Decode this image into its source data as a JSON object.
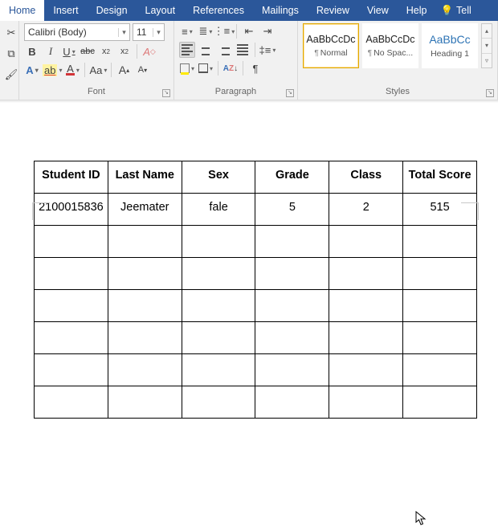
{
  "tabs": {
    "home": "Home",
    "insert": "Insert",
    "design": "Design",
    "layout": "Layout",
    "references": "References",
    "mailings": "Mailings",
    "review": "Review",
    "view": "View",
    "help": "Help",
    "tell": "Tell"
  },
  "font": {
    "group_label": "Font",
    "family": "Calibri (Body)",
    "size": "11",
    "bold": "B",
    "italic": "I",
    "underline": "U",
    "strike": "abc",
    "sub": "x",
    "sup": "x",
    "clear": "A",
    "effects": "A",
    "highlight": "ab",
    "color": "A",
    "case": "Aa",
    "grow": "A",
    "shrink": "A"
  },
  "para": {
    "group_label": "Paragraph",
    "sort": "A↓",
    "pilcrow": "¶"
  },
  "styles": {
    "group_label": "Styles",
    "preview": "AaBbCcDc",
    "preview_h": "AaBbCc",
    "normal": "Normal",
    "nospace": "No Spac...",
    "heading1": "Heading 1"
  },
  "table": {
    "headers": [
      "Student ID",
      "Last Name",
      "Sex",
      "Grade",
      "Class",
      "Total Score"
    ],
    "rows": [
      [
        "2100015836",
        "Jeemater",
        "fale",
        "5",
        "2",
        "515"
      ],
      [
        "",
        "",
        "",
        "",
        "",
        ""
      ],
      [
        "",
        "",
        "",
        "",
        "",
        ""
      ],
      [
        "",
        "",
        "",
        "",
        "",
        ""
      ],
      [
        "",
        "",
        "",
        "",
        "",
        ""
      ],
      [
        "",
        "",
        "",
        "",
        "",
        ""
      ],
      [
        "",
        "",
        "",
        "",
        "",
        ""
      ]
    ]
  }
}
